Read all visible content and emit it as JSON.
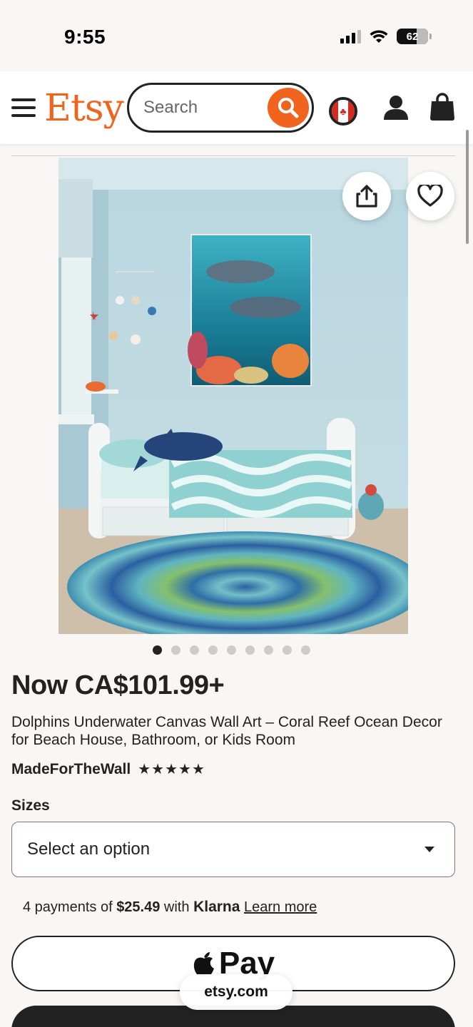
{
  "status_bar": {
    "time": "9:55",
    "battery": "62"
  },
  "header": {
    "logo": "Etsy",
    "search": {
      "placeholder": "Search",
      "value": ""
    }
  },
  "product": {
    "image_count": 9,
    "active_image": 1,
    "price": "Now CA$101.99+",
    "title": "Dolphins Underwater Canvas Wall Art – Coral Reef Ocean Decor for Beach House, Bathroom, or Kids Room",
    "shop_name": "MadeForTheWall",
    "stars": "★★★★★",
    "rating": 5,
    "sizes_label": "Sizes",
    "sizes_selected": "Select an option"
  },
  "klarna": {
    "prefix": "4 payments of",
    "amount": "$25.49",
    "with": "with",
    "brand": "Klarna",
    "learn_more": "Learn more"
  },
  "apple_pay": {
    "label": "Pay"
  },
  "browser": {
    "url": "etsy.com"
  },
  "colors": {
    "brand": "#f1641e",
    "background": "#f8f7f5",
    "text": "#222222"
  }
}
